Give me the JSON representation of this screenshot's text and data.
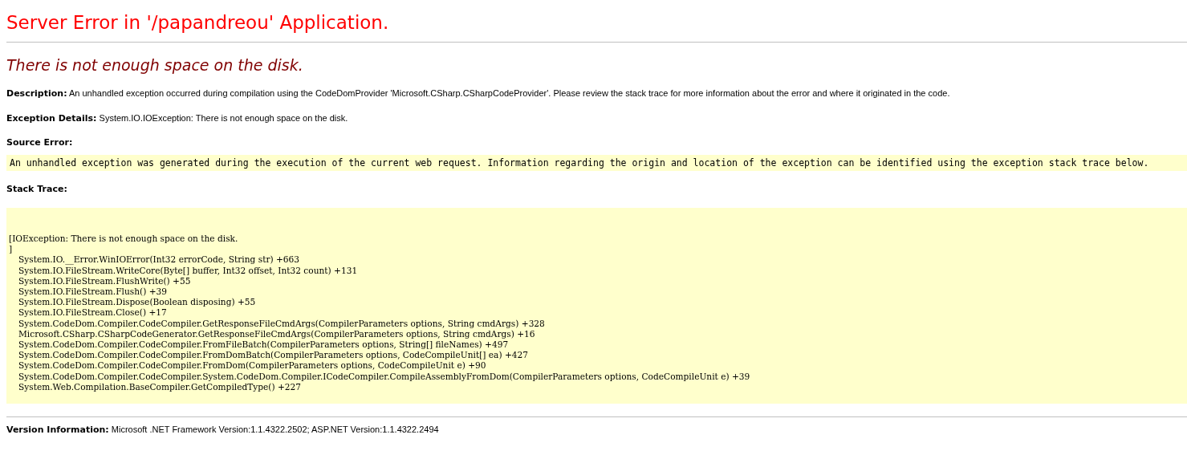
{
  "page_title": "Server Error in '/papandreou' Application.",
  "error_heading": "There is not enough space on the disk.",
  "description": "**Description:** An unhandled exception occurred during compilation using the CodeDomProvider 'Microsoft.CSharp.CSharpCodeProvider'. Please review the stack trace for more information about the error and where it originated in the code.",
  "exception_details": "**Exception Details:** System.IO.IOException: There is not enough space on the disk.",
  "source_error": {
    "label": "Source Error:",
    "text": "An unhandled exception was generated during the execution of the current web request. Information regarding the origin and location of the exception can be identified using the exception stack trace below."
  },
  "stack_trace": {
    "label": "Stack Trace:",
    "header": [
      "[IOException: There is not enough space on the disk.",
      "]"
    ],
    "frames": [
      "System.IO.__Error.WinIOError(Int32 errorCode, String str) +663",
      "System.IO.FileStream.WriteCore(Byte[] buffer, Int32 offset, Int32 count) +131",
      "System.IO.FileStream.FlushWrite() +55",
      "System.IO.FileStream.Flush() +39",
      "System.IO.FileStream.Dispose(Boolean disposing) +55",
      "System.IO.FileStream.Close() +17",
      "System.CodeDom.Compiler.CodeCompiler.GetResponseFileCmdArgs(CompilerParameters options, String cmdArgs) +328",
      "Microsoft.CSharp.CSharpCodeGenerator.GetResponseFileCmdArgs(CompilerParameters options, String cmdArgs) +16",
      "System.CodeDom.Compiler.CodeCompiler.FromFileBatch(CompilerParameters options, String[] fileNames) +497",
      "System.CodeDom.Compiler.CodeCompiler.FromDomBatch(CompilerParameters options, CodeCompileUnit[] ea) +427",
      "System.CodeDom.Compiler.CodeCompiler.FromDom(CompilerParameters options, CodeCompileUnit e) +90",
      "System.CodeDom.Compiler.CodeCompiler.System.CodeDom.Compiler.ICodeCompiler.CompileAssemblyFromDom(CompilerParameters options, CodeCompileUnit e) +39",
      "System.Web.Compilation.BaseCompiler.GetCompiledType() +227"
    ]
  },
  "version_info": "**Version Information:** Microsoft .NET Framework Version:1.1.4322.2502; ASP.NET Version:1.1.4322.2494"
}
